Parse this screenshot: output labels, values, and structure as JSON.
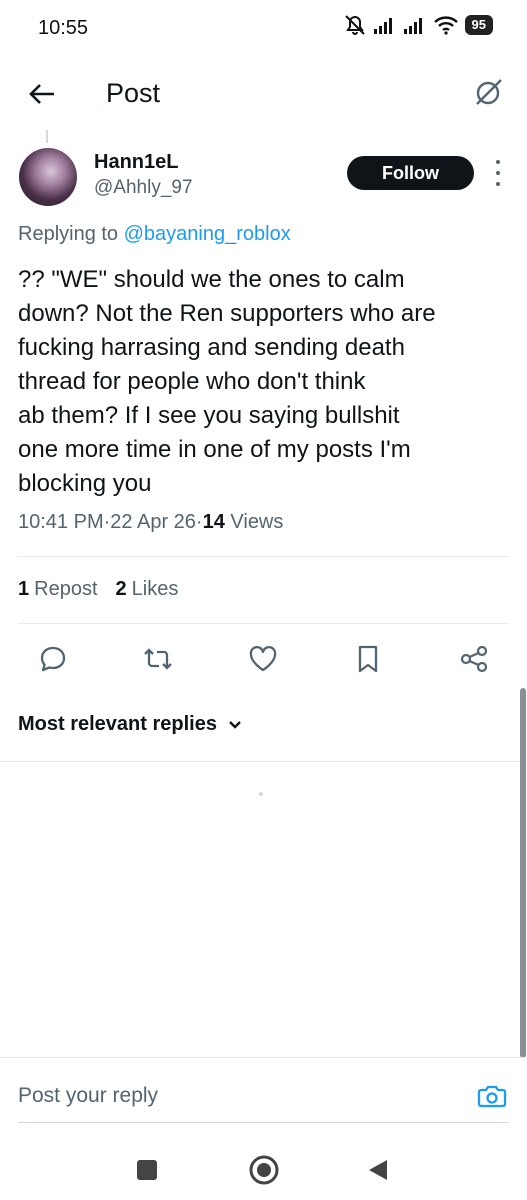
{
  "status_bar": {
    "time": "10:55",
    "battery": "95"
  },
  "header": {
    "title": "Post"
  },
  "post": {
    "display_name": "Hann1eL",
    "handle": "@Ahhly_97",
    "follow_label": "Follow",
    "replying_prefix": "Replying to ",
    "replying_to": "@bayaning_roblox",
    "text": "?? \"WE\" should we the ones to calm\ndown? Not the Ren supporters who are\nfucking harrasing and sending death\nthread for people who don't think\nab them? If I see you saying bullshit\none more time in one of my posts I'm\nblocking you",
    "time": "10:41 PM",
    "date": "22 Apr 26",
    "views_count": "14",
    "views_label": "Views",
    "separator": " · "
  },
  "stats": {
    "reposts_count": "1",
    "reposts_label": "Repost",
    "likes_count": "2",
    "likes_label": "Likes"
  },
  "actions": [
    "reply-icon",
    "repost-icon",
    "like-icon",
    "bookmark-icon",
    "share-icon"
  ],
  "replies": {
    "sort_label": "Most relevant replies"
  },
  "composer": {
    "placeholder": "Post your reply"
  },
  "colors": {
    "accent": "#1d9bf0",
    "text": "#0f1419",
    "muted": "#536471",
    "follow_bg": "#0f1419"
  }
}
